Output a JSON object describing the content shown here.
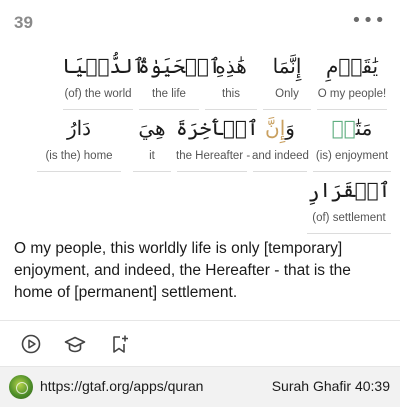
{
  "verse": {
    "number": "39"
  },
  "menu": {
    "icon": "more-horizontal-icon",
    "glyph": "•••"
  },
  "words": [
    {
      "arabic": "يَٰقَوۡمِ",
      "translation": "O my people!"
    },
    {
      "arabic": "إِنَّمَا",
      "translation": "Only"
    },
    {
      "arabic": "هَٰذِهِ",
      "translation": "this"
    },
    {
      "arabic": "ٱلۡحَيَوٰةُ",
      "translation": "the life"
    },
    {
      "arabic": "ٱلدُّنۡيَا",
      "translation": "(of) the world"
    },
    {
      "arabic_main": "مَتَٰ",
      "arabic_hl": "عٞ",
      "translation": "(is) enjoyment"
    },
    {
      "arabic_main": "وَ",
      "arabic_hl": "إِنَّ",
      "translation": "and indeed"
    },
    {
      "arabic": "ٱلۡأٓخِرَةَ",
      "translation": "the Hereafter -"
    },
    {
      "arabic": "هِيَ",
      "translation": "it"
    },
    {
      "arabic": "دَارُ",
      "translation": "(is the) home"
    },
    {
      "arabic": "ٱلۡقَرَارِ",
      "translation": "(of) settlement"
    }
  ],
  "translation": "O my people, this worldly life is only [temporary] enjoyment, and indeed, the Hereafter - that is the home of [permanent] settlement.",
  "actions": [
    {
      "name": "play-icon"
    },
    {
      "name": "graduation-cap-icon"
    },
    {
      "name": "bookmark-add-icon"
    }
  ],
  "footer": {
    "logo": "quran-logo-icon",
    "url": "https://gtaf.org/apps/quran",
    "reference": "Surah Ghafir 40:39"
  }
}
